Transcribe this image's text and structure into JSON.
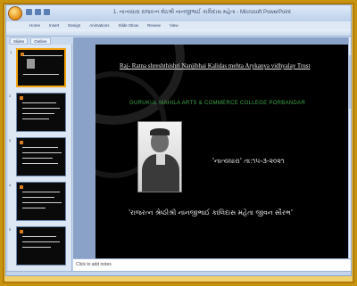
{
  "window": {
    "title": "1. નાત્યધારા રાજરત્ન શેઠશ્રી નાનજીભાઈ કાલિદાસ મહેતા - Microsoft PowerPoint"
  },
  "menu": [
    "Home",
    "Insert",
    "Design",
    "Animations",
    "Slide Show",
    "Review",
    "View"
  ],
  "panel_tabs": [
    "Slides",
    "Outline"
  ],
  "slide": {
    "heading": "Raj- Ratna shreshthishri Nanjibhai Kalidas mehta Arykanya vidhyalay Trust",
    "college": "GURUKUL MAHILA ARTS & COMMERCE COLLEGE PORBANDAR",
    "date_text": "'નાત્યધારા' તા:૧૫-૩-૨૦૨૧",
    "title_text": "'રાજરત્ન શ્રેષ્ઠીશ્રી નાનજીભાઈ કાલિદાસ મહેતા જીવન સૌરભ'"
  },
  "notes_placeholder": "Click to add notes",
  "thumbnails": [
    {
      "number": "1",
      "selected": true
    },
    {
      "number": "2",
      "selected": false
    },
    {
      "number": "3",
      "selected": false
    },
    {
      "number": "4",
      "selected": false
    },
    {
      "number": "5",
      "selected": false
    }
  ]
}
